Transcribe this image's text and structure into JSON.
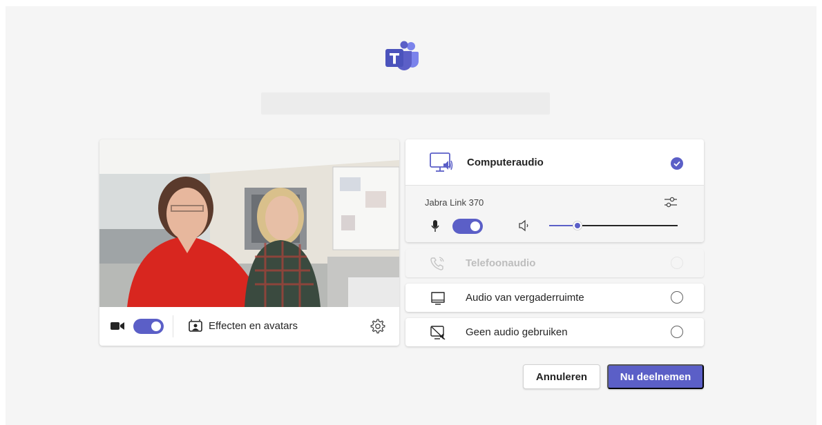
{
  "app": {
    "name": "Microsoft Teams",
    "accent_color": "#5b5fc7",
    "logo_icon": "teams-logo-icon"
  },
  "meeting": {
    "title": ""
  },
  "video": {
    "camera_icon": "camera-icon",
    "camera_on": true,
    "effects_icon": "effects-icon",
    "effects_label": "Effecten en avatars",
    "settings_icon": "gear-icon"
  },
  "audio": {
    "computer": {
      "icon": "computer-audio-icon",
      "label": "Computeraudio",
      "selected": true,
      "device_name": "Jabra Link 370",
      "device_settings_icon": "sliders-icon",
      "mic_icon": "microphone-icon",
      "mic_on": true,
      "speaker_icon": "speaker-icon",
      "volume_fraction": 0.22
    },
    "phone": {
      "icon": "phone-icon",
      "label": "Telefoonaudio",
      "disabled": true
    },
    "room": {
      "icon": "room-audio-icon",
      "label": "Audio van vergaderruimte"
    },
    "none": {
      "icon": "no-audio-icon",
      "label": "Geen audio gebruiken"
    }
  },
  "actions": {
    "cancel_label": "Annuleren",
    "join_label": "Nu deelnemen"
  }
}
